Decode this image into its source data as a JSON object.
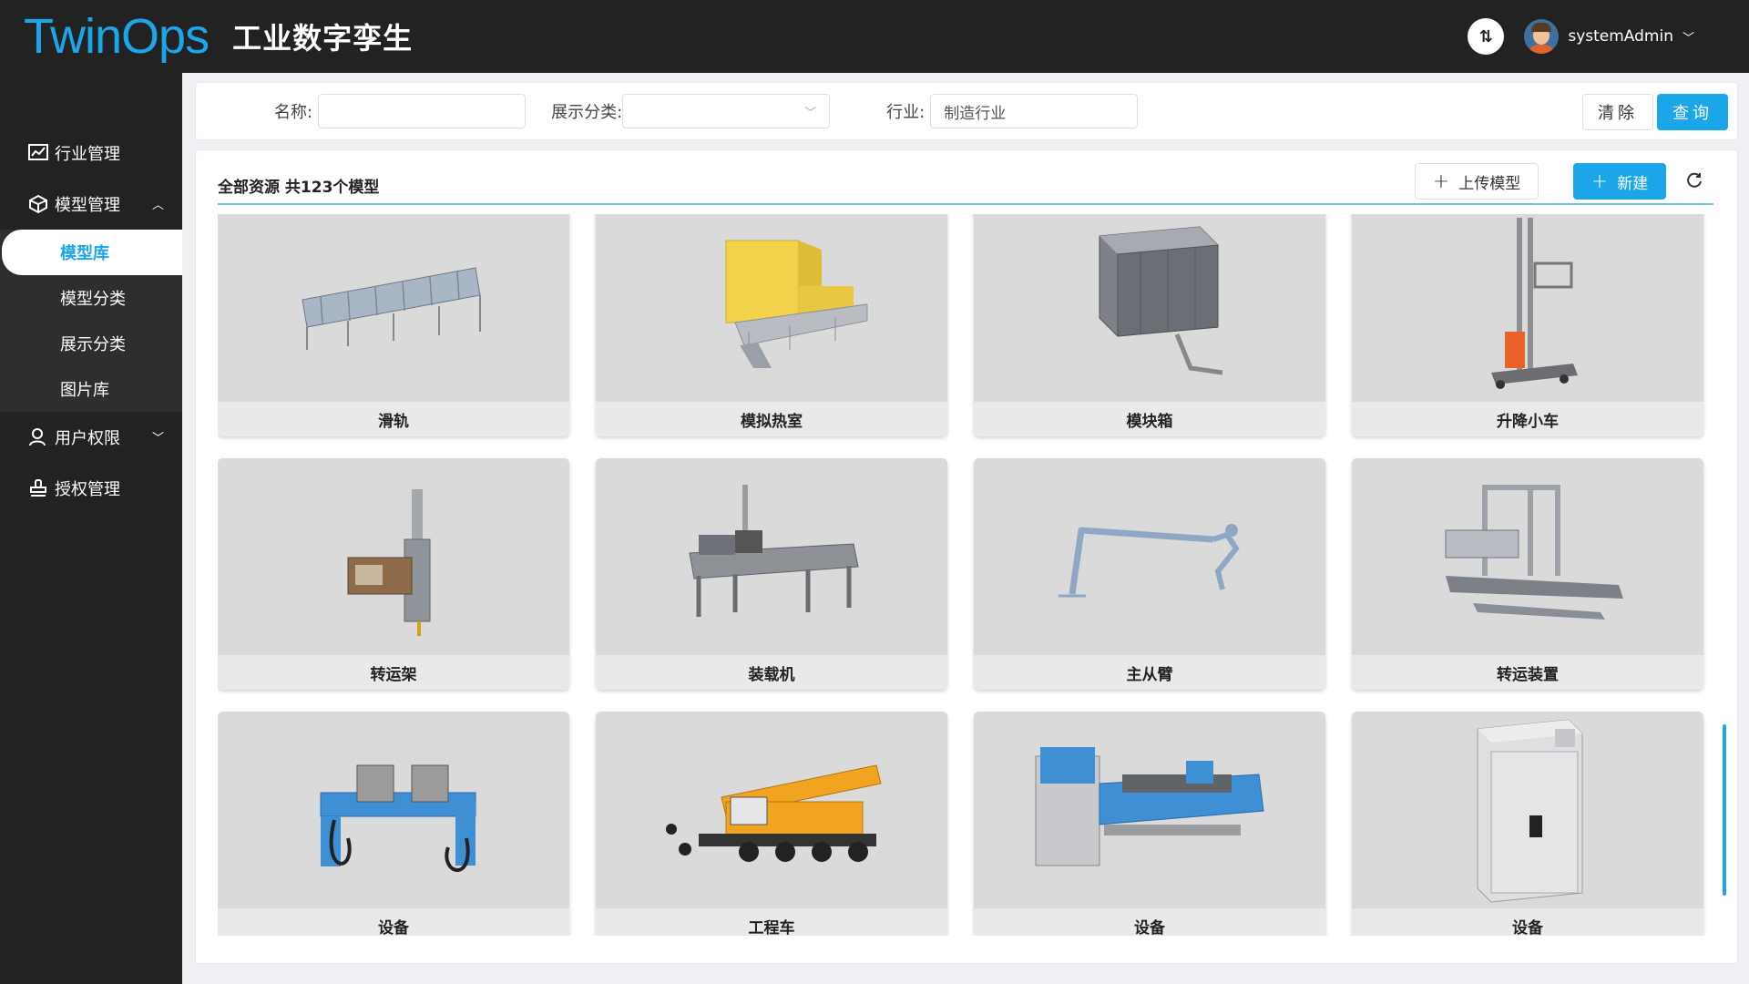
{
  "header": {
    "logo": "TwinOps",
    "title": "工业数字孪生",
    "user": "systemAdmin"
  },
  "sidebar": {
    "items": [
      {
        "label": "行业管理",
        "icon": "chart-icon"
      },
      {
        "label": "模型管理",
        "icon": "model-icon",
        "expanded": true
      },
      {
        "label": "用户权限",
        "icon": "user-icon"
      },
      {
        "label": "授权管理",
        "icon": "stamp-icon"
      }
    ],
    "sub_items": [
      "模型库",
      "模型分类",
      "展示分类",
      "图片库"
    ]
  },
  "filter": {
    "name_label": "名称:",
    "name_value": "",
    "category_label": "展示分类:",
    "category_value": "",
    "industry_label": "行业:",
    "industry_value": "制造行业",
    "clear_label": "清除",
    "query_label": "查询"
  },
  "panel": {
    "title": "全部资源 共123个模型",
    "upload_label": "上传模型",
    "new_label": "新建"
  },
  "models": [
    {
      "name": "滑轨"
    },
    {
      "name": "模拟热室"
    },
    {
      "name": "模块箱"
    },
    {
      "name": "升降小车"
    },
    {
      "name": "转运架"
    },
    {
      "name": "装载机"
    },
    {
      "name": "主从臂"
    },
    {
      "name": "转运装置"
    },
    {
      "name": "设备"
    },
    {
      "name": "工程车"
    },
    {
      "name": "设备"
    },
    {
      "name": "设备"
    }
  ],
  "colors": {
    "accent": "#1aa6e8",
    "dark": "#222222"
  }
}
